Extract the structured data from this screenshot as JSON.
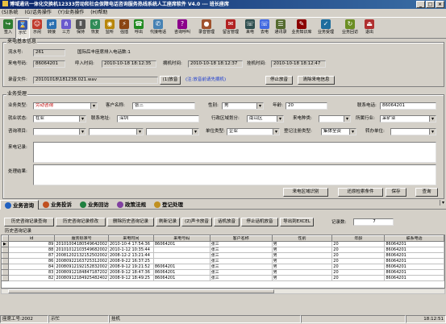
{
  "window": {
    "title": "博域通讯一体化交换机12333劳动和社会保障电话咨询服务热线系统人工座席软件 V4.0 --- 班长座席"
  },
  "menu": [
    "(S)系统",
    "(G)话务操作",
    "(Y)业务操作",
    "(H)帮助"
  ],
  "toolbar": [
    {
      "label": "签入",
      "icon": "sign-in-icon",
      "color": "#2f7d32"
    },
    {
      "label": "示忙",
      "icon": "busy-icon",
      "color": "#3355aa",
      "active": true
    },
    {
      "label": "示闲",
      "icon": "idle-icon",
      "color": "#c0392b"
    },
    {
      "label": "转接",
      "icon": "transfer-icon",
      "color": "#2a6fb0"
    },
    {
      "label": "三方",
      "icon": "three-way-icon",
      "color": "#6a5acd"
    },
    {
      "label": "保持",
      "icon": "hold-icon",
      "color": "#555555"
    },
    {
      "label": "恢复",
      "icon": "resume-icon",
      "color": "#2e8b57"
    },
    {
      "label": "监听",
      "icon": "monitor-icon",
      "color": "#b8860b"
    },
    {
      "label": "强插",
      "icon": "barge-in-icon",
      "color": "#8b4513"
    },
    {
      "label": "呼出",
      "icon": "call-out-icon",
      "color": "#228b22"
    },
    {
      "label": "代接电话",
      "icon": "pickup-icon",
      "color": "#4682b4"
    },
    {
      "label": "咨询呼叫",
      "icon": "consult-icon",
      "color": "#8b008b"
    },
    {
      "label": "录音管理",
      "icon": "recording-icon",
      "color": "#a0522d"
    },
    {
      "label": "留言管理",
      "icon": "message-icon",
      "color": "#b22222"
    },
    {
      "label": "来电",
      "icon": "incoming-icon",
      "color": "#2f4f4f"
    },
    {
      "label": "去电",
      "icon": "outgoing-icon",
      "color": "#4169e1"
    },
    {
      "label": "通讯录",
      "icon": "contacts-icon",
      "color": "#556b2f"
    },
    {
      "label": "业务知识库",
      "icon": "knowledge-icon",
      "color": "#8b0000"
    },
    {
      "label": "业务受理",
      "icon": "accept-icon",
      "color": "#1e6e9e"
    },
    {
      "label": "业务回访",
      "icon": "callback-icon",
      "color": "#6b8e23"
    },
    {
      "label": "退出",
      "icon": "exit-icon",
      "color": "#b03030"
    }
  ],
  "call_info": {
    "legend": "来电基本信息",
    "serial_label": "流水号:",
    "serial_value": "261",
    "queue_text": "国际后丰座席排入电话数:1",
    "caller_label": "来电号码:",
    "caller_value": "86064201",
    "in_time_label": "呼入时间:",
    "in_time_value": "2010-10-18 18:12:35",
    "pick_time_label": "摘机时间:",
    "pick_time_value": "2010-10-18 18:12:37",
    "hang_time_label": "挂机时间:",
    "hang_time_value": "2010-10-18 18:12:47",
    "record_label": "录音文件:",
    "record_value": "20101018\\181238.021.wav",
    "play_button": "(1)放音",
    "play_hint": "(注:放音前请先摘机)",
    "stop_button": "停止放音",
    "clear_button": "清除来电信息"
  },
  "accept": {
    "legend": "业务受理",
    "biz_type_label": "业务类型:",
    "biz_type_value": "劳动咨询",
    "customer_label": "客户名称:",
    "customer_value": "张三",
    "gender_label": "性别:",
    "gender_value": "男",
    "age_label": "年龄:",
    "age_value": "20",
    "phone_label": "联系电话:",
    "phone_value": "86064201",
    "employ_label": "就业状态:",
    "employ_value": "在业",
    "address_label": "联系地址:",
    "address_value": "深圳",
    "district_label": "行政区域划分:",
    "district_value": "南山区",
    "caller_type_label": "来电种类:",
    "caller_type_value": "",
    "industry_label": "所属行业:",
    "industry_value": "采矿业",
    "consult_label": "咨询项目:",
    "consult_value": "",
    "unit_type_label": "单位类型:",
    "unit_type_value": "企业",
    "reg_type_label": "登记注册类型:",
    "reg_type_value": "集体全资",
    "transfer_label": "转办单位:",
    "transfer_value": "",
    "record_label": "来电记录:",
    "result_label": "处理结果:",
    "btn_area": "来电区域识别",
    "btn_restore": "还原检索条件",
    "btn_save": "保存",
    "btn_query": "查询"
  },
  "tabs": [
    {
      "label": "业务咨询",
      "icon": "consult-tab-icon",
      "color": "#2060c0",
      "selected": true
    },
    {
      "label": "业务投诉",
      "icon": "complaint-tab-icon",
      "color": "#c05020"
    },
    {
      "label": "业务回访",
      "icon": "revisit-tab-icon",
      "color": "#208040"
    },
    {
      "label": "政策法规",
      "icon": "policy-tab-icon",
      "color": "#8040a0"
    },
    {
      "label": "登记处理",
      "icon": "register-tab-icon",
      "color": "#c09020"
    }
  ],
  "history_buttons": [
    "历史咨询记录查询",
    "历史咨询记录修改",
    "删除历史咨询记录",
    "刷新记录",
    "(2)声卡放音",
    "话机放音",
    "停止话机放音",
    "导出到EXCEL"
  ],
  "record_count_label": "记录数:",
  "record_count_value": "7",
  "history": {
    "legend": "历史咨询记录",
    "columns": [
      "id",
      "服务标准号",
      "来电时间",
      "来电号码",
      "客户名称",
      "性别",
      "年龄",
      "联系电话"
    ],
    "rows": [
      [
        "89",
        "20101004180549642002",
        "2010-10-4 17:54:36",
        "86064201",
        "张三",
        "男",
        "20",
        "86064201"
      ],
      [
        "88",
        "20101012103549682002",
        "2010-1-12 10:35:44",
        "",
        "张三",
        "男",
        "20",
        "86064201"
      ],
      [
        "87",
        "20081202132152502002",
        "2008-12-2 13:21:44",
        "",
        "张三",
        "男",
        "20",
        "86064201"
      ],
      [
        "86",
        "20080922163725312002",
        "2008-9-22 16:37:25",
        "",
        "张三",
        "男",
        "20",
        "86064201"
      ],
      [
        "84",
        "20080912192152832002",
        "2008-9-12 19:21:52",
        "86064201",
        "张三",
        "男",
        "20",
        "86064201"
      ],
      [
        "83",
        "20080912184847187202",
        "2008-9-12 18:47:36",
        "86064201",
        "张三",
        "男",
        "20",
        "86064201"
      ],
      [
        "82",
        "20080912184925482402",
        "2008-9-12 18:49:25",
        "86064201",
        "张三",
        "男",
        "20",
        "86064201"
      ]
    ]
  },
  "status": {
    "agent_label": "座席工号:",
    "agent_value": "2002",
    "state_value": "示忙",
    "phone_state": "挂机",
    "clock": "18:12:51"
  }
}
